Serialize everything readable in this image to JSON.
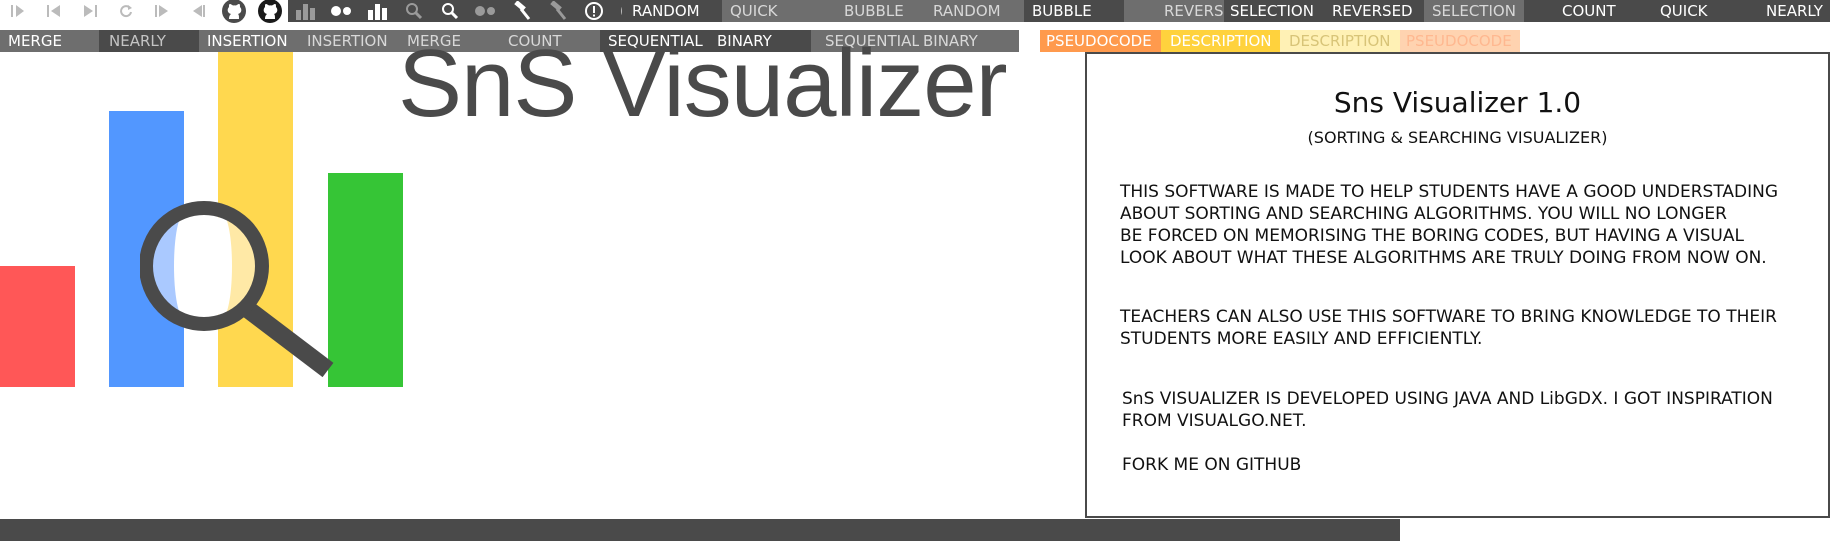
{
  "colors": {
    "dark": "#4a4a4a",
    "mid": "#6e6e6e",
    "red": "#ff5757",
    "blue": "#5297ff",
    "yellow": "#ffd84f",
    "green": "#36c536",
    "pseudocode": "#ff9a4d",
    "description": "#ffd23d"
  },
  "icon_strip": [
    "play-pause-icon",
    "skip-start-icon",
    "skip-end-icon",
    "replay-icon",
    "step-forward-icon",
    "step-back-icon",
    "github-icon",
    "github-icon",
    "bar-chart-icon",
    "dots-icon",
    "bar-chart-icon",
    "search-icon",
    "search-icon",
    "dots-icon",
    "hammer-icon",
    "hammer-icon",
    "info-icon",
    "info-icon"
  ],
  "top_row": [
    "RANDOM",
    "QUICK",
    "BUBBLE",
    "RANDOM",
    "BUBBLE",
    "REVERSED",
    "SELECTION",
    "REVERSED",
    "SELECTION",
    "COUNT",
    "QUICK",
    "NEARLY"
  ],
  "second_row": {
    "sort_buttons": [
      "MERGE",
      "NEARLY",
      "INSERTION",
      "INSERTION",
      "MERGE",
      "COUNT"
    ],
    "search_buttons": [
      "SEQUENTIAL",
      "BINARY",
      "SEQUENTIAL",
      "BINARY"
    ],
    "mode_buttons": [
      "PSEUDOCODE",
      "DESCRIPTION",
      "DESCRIPTION",
      "PSEUDOCODE"
    ]
  },
  "logo": {
    "title": "SnS Visualizer"
  },
  "panel": {
    "title": "Sns Visualizer 1.0",
    "subtitle": "(SORTING & SEARCHING VISUALIZER)",
    "paragraph_1": "THIS SOFTWARE IS MADE TO HELP STUDENTS HAVE A GOOD UNDERSTADING\nABOUT SORTING AND SEARCHING ALGORITHMS. YOU WILL NO LONGER\nBE FORCED ON MEMORISING THE BORING CODES, BUT HAVING A VISUAL\nLOOK ABOUT WHAT THESE ALGORITHMS ARE TRULY DOING FROM NOW ON.",
    "paragraph_2": "TEACHERS CAN ALSO USE THIS SOFTWARE TO BRING KNOWLEDGE TO THEIR\nSTUDENTS MORE EASILY AND EFFICIENTLY.",
    "paragraph_3": "SnS VISUALIZER IS DEVELOPED USING JAVA AND LibGDX. I GOT INSPIRATION\nFROM VISUALGO.NET.",
    "paragraph_4": "FORK ME ON GITHUB"
  }
}
